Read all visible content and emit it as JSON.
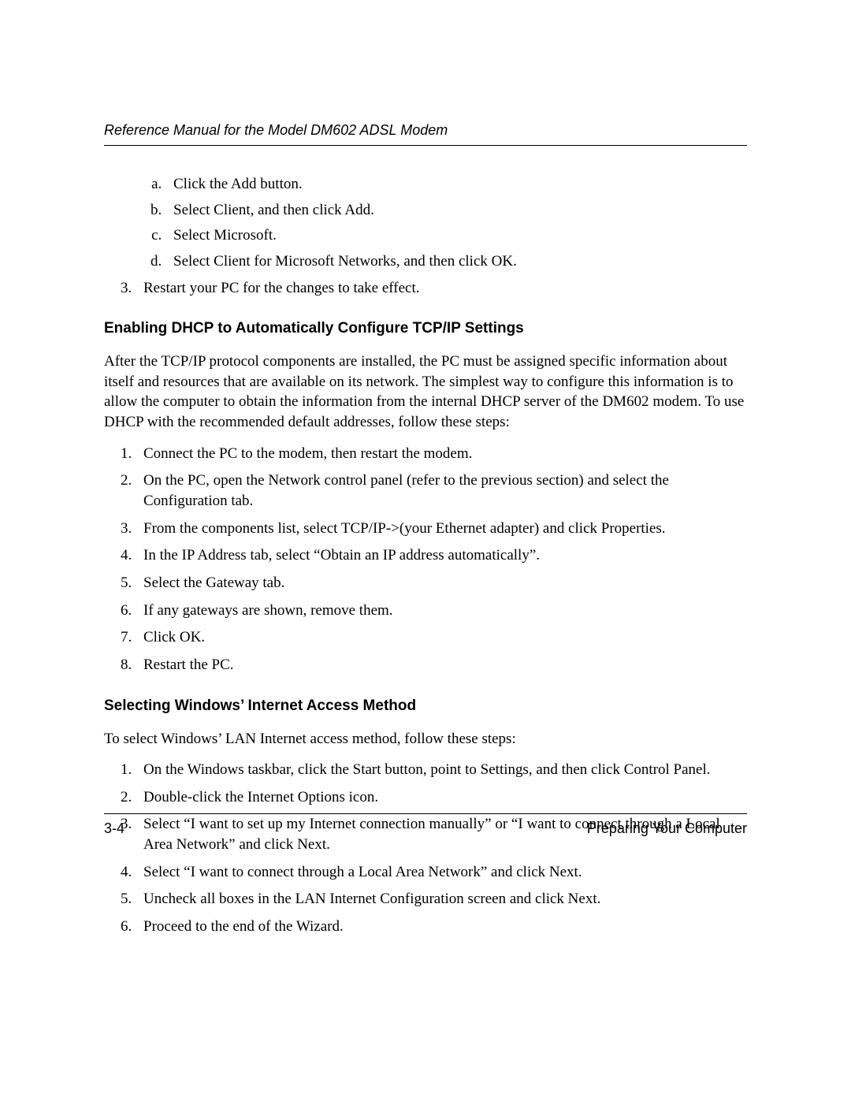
{
  "header": {
    "running_title": "Reference Manual for the Model DM602 ADSL Modem"
  },
  "continued_sublist": {
    "items": [
      "Click the Add button.",
      "Select Client, and then click Add.",
      "Select Microsoft.",
      "Select Client for Microsoft Networks, and then click OK."
    ]
  },
  "continued_numbered": {
    "start": 3,
    "items": [
      "Restart your PC for the changes to take effect."
    ]
  },
  "section1": {
    "heading": "Enabling DHCP to Automatically Configure TCP/IP Settings",
    "paragraph": "After the TCP/IP protocol components are installed, the PC must be assigned specific information about itself and resources that are available on its network. The simplest way to configure this information is to allow the computer to obtain the information from the internal DHCP server of the DM602 modem. To use DHCP with the recommended default addresses, follow these steps:",
    "steps": [
      "Connect the PC to the modem, then restart the modem.",
      "On the PC, open the Network control panel (refer to the previous section) and select the Configuration tab.",
      "From the components list, select TCP/IP->(your Ethernet adapter) and click Properties.",
      "In the IP Address tab, select “Obtain an IP address automatically”.",
      "Select the Gateway tab.",
      "If any gateways are shown, remove them.",
      "Click OK.",
      "Restart the PC."
    ]
  },
  "section2": {
    "heading": "Selecting Windows’ Internet Access Method",
    "paragraph": "To select Windows’ LAN Internet access method, follow these steps:",
    "steps": [
      "On the Windows taskbar, click the Start button, point to Settings, and then click Control Panel.",
      "Double-click the Internet Options icon.",
      "Select “I want to set up my Internet connection manually” or “I want to connect through a Local Area Network” and click Next.",
      "Select “I want to connect through a Local Area Network” and click Next.",
      "Uncheck all boxes in the LAN Internet Configuration screen and click Next.",
      "Proceed to the end of the Wizard."
    ]
  },
  "footer": {
    "page_number": "3-4",
    "section_title": "Preparing Your Computer"
  }
}
